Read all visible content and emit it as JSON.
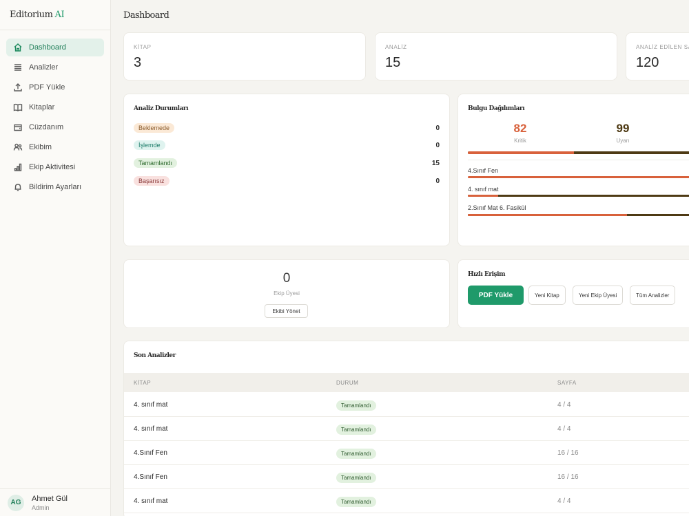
{
  "brand": {
    "name": "Editorium",
    "suffix": "AI"
  },
  "sidebar": {
    "items": [
      {
        "label": "Dashboard",
        "icon": "home-icon",
        "active": true
      },
      {
        "label": "Analizler",
        "icon": "list-icon"
      },
      {
        "label": "PDF Yükle",
        "icon": "upload-icon"
      },
      {
        "label": "Kitaplar",
        "icon": "book-icon"
      },
      {
        "label": "Cüzdanım",
        "icon": "wallet-icon"
      },
      {
        "label": "Ekibim",
        "icon": "users-icon"
      },
      {
        "label": "Ekip Aktivitesi",
        "icon": "bar-chart-icon"
      },
      {
        "label": "Bildirim Ayarları",
        "icon": "bell-icon"
      }
    ]
  },
  "user": {
    "initials": "AG",
    "name": "Ahmet Gül",
    "role": "Admin"
  },
  "header": {
    "title": "Dashboard"
  },
  "stats": [
    {
      "label": "KİTAP",
      "value": "3"
    },
    {
      "label": "ANALİZ",
      "value": "15"
    },
    {
      "label": "ANALİZ EDİLEN SAY",
      "value": "120"
    }
  ],
  "status_card": {
    "title": "Analiz Durumları",
    "rows": [
      {
        "label": "Beklemede",
        "count": "0",
        "kind": "wait"
      },
      {
        "label": "İşlemde",
        "count": "0",
        "kind": "proc"
      },
      {
        "label": "Tamamlandı",
        "count": "15",
        "kind": "done"
      },
      {
        "label": "Başarısız",
        "count": "0",
        "kind": "fail"
      }
    ]
  },
  "findings_card": {
    "title": "Bulgu Dağılımları",
    "critical": {
      "value": "82",
      "label": "Kritik",
      "color": "#d8613b"
    },
    "warning": {
      "value": "99",
      "label": "Uyarı",
      "color": "#4e3a14"
    },
    "total_bar": {
      "critical_fraction": 0.453
    },
    "books": [
      {
        "name": "4.Sınıf Fen",
        "critical_fraction": 1.0
      },
      {
        "name": "4. sınıf mat",
        "critical_fraction": 0.13
      },
      {
        "name": "2.Sınıf Mat 6. Fasikül",
        "critical_fraction": 0.68
      }
    ]
  },
  "team_card": {
    "count": "0",
    "label": "Ekip Üyesi",
    "button": "Ekibi Yönet"
  },
  "quick_card": {
    "title": "Hızlı Erişim",
    "primary": "PDF Yükle",
    "buttons": [
      "Yeni Kitap",
      "Yeni Ekip Üyesi",
      "Tüm Analizler"
    ]
  },
  "recent": {
    "title": "Son Analizler",
    "columns": {
      "book": "KİTAP",
      "status": "DURUM",
      "page": "SAYFA"
    },
    "rows": [
      {
        "book": "4. sınıf mat",
        "status": "Tamamlandı",
        "page": "4 / 4"
      },
      {
        "book": "4. sınıf mat",
        "status": "Tamamlandı",
        "page": "4 / 4"
      },
      {
        "book": "4.Sınıf Fen",
        "status": "Tamamlandı",
        "page": "16 / 16"
      },
      {
        "book": "4.Sınıf Fen",
        "status": "Tamamlandı",
        "page": "16 / 16"
      },
      {
        "book": "4. sınıf mat",
        "status": "Tamamlandı",
        "page": "4 / 4"
      }
    ]
  }
}
